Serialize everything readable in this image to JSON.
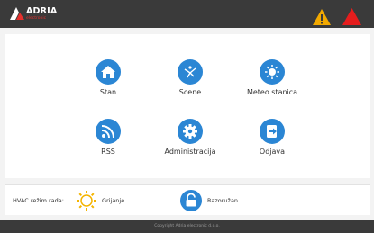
{
  "header": {
    "logo_text": "ADRIA",
    "logo_subtext": "electronic",
    "warning_icon": "warning-triangle-icon",
    "alarm_icon": "alarm-triangle-icon",
    "colors": {
      "bar": "#3a3a3a",
      "warning": "#f2a900",
      "alarm": "#e51d1d"
    }
  },
  "menu": {
    "accent": "#2b86d4",
    "items": [
      {
        "label": "Stan",
        "icon": "home-icon"
      },
      {
        "label": "Scene",
        "icon": "scene-icon"
      },
      {
        "label": "Meteo stanica",
        "icon": "sun-icon"
      },
      {
        "label": "RSS",
        "icon": "rss-icon"
      },
      {
        "label": "Administracija",
        "icon": "gear-icon"
      },
      {
        "label": "Odjava",
        "icon": "logout-icon"
      }
    ]
  },
  "status": {
    "hvac_label": "HVAC režim rada:",
    "hvac_mode": "Grijanje",
    "alarm_state": "Razoružan"
  },
  "footer": {
    "copyright": "Copyright Adria electronic d.o.o."
  }
}
